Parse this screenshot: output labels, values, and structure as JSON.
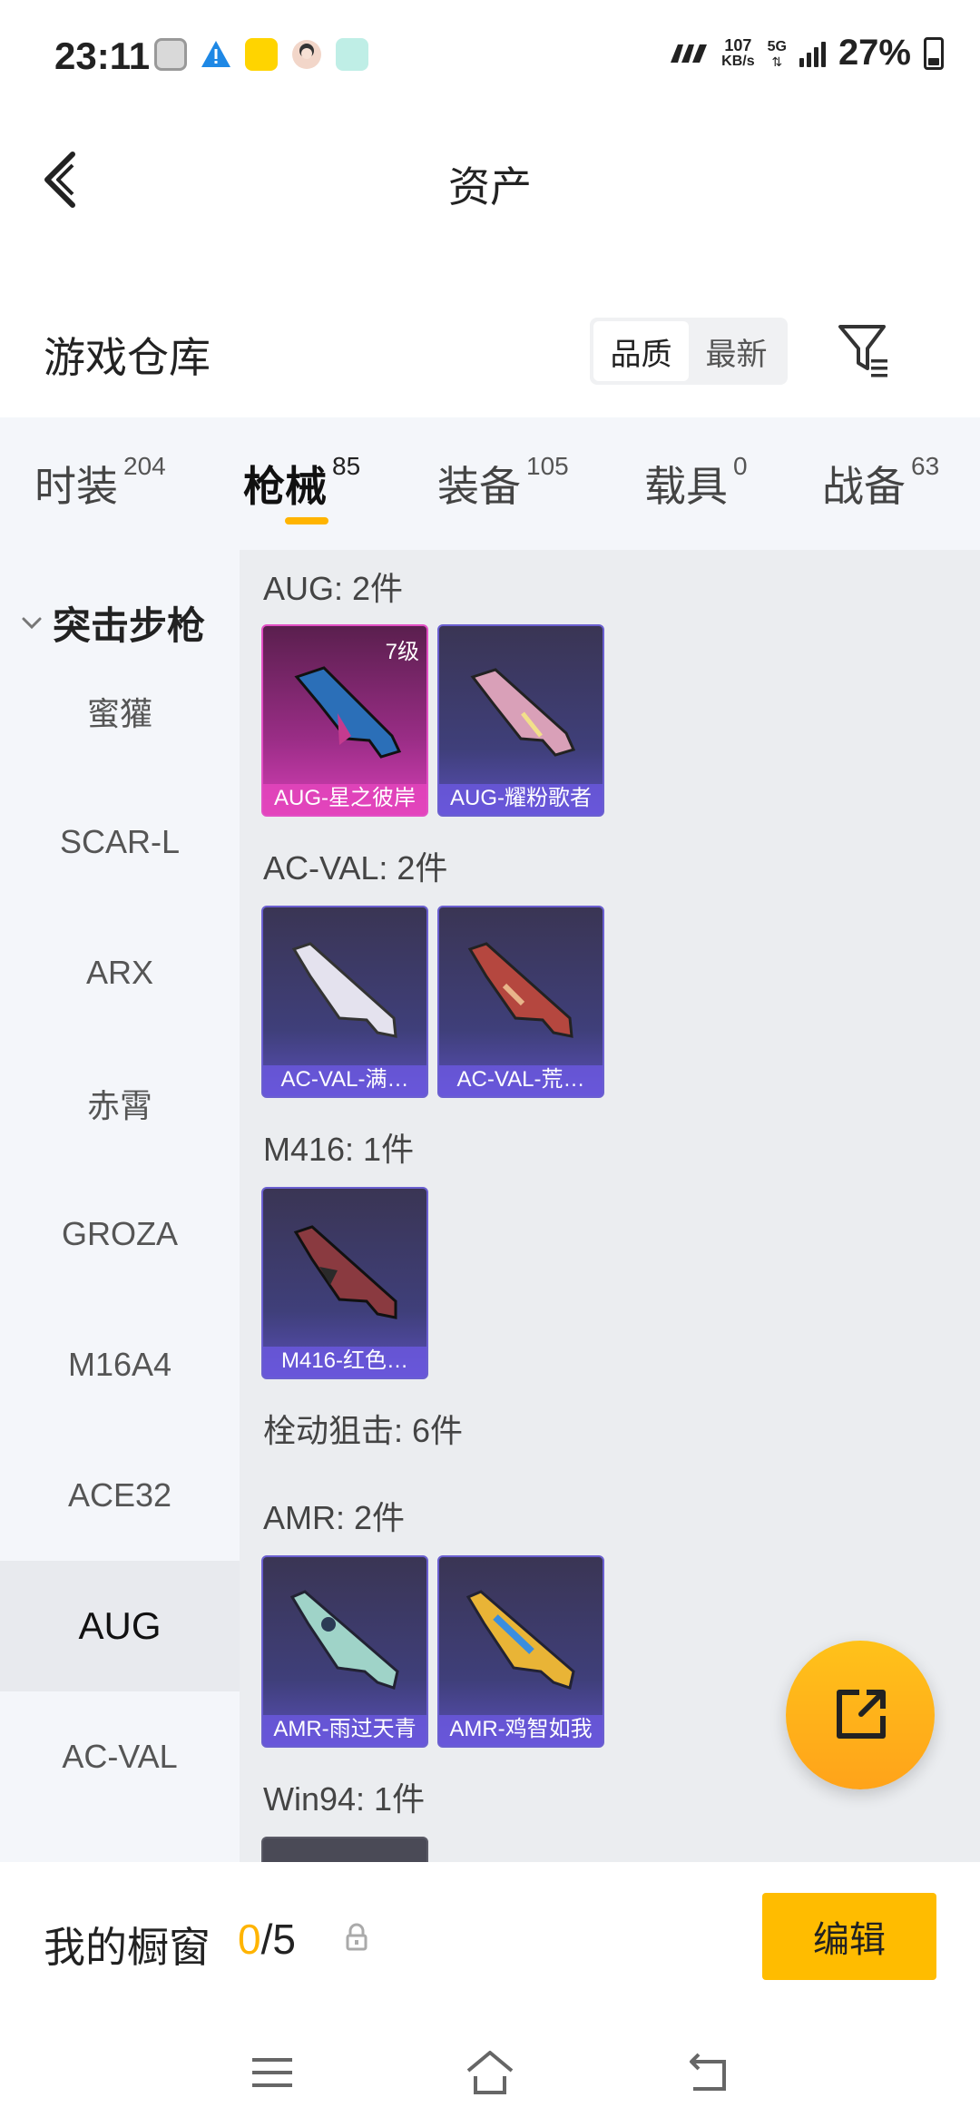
{
  "status_bar": {
    "time": "23:11",
    "net_speed_value": "107",
    "net_speed_unit": "KB/s",
    "network": "5G",
    "battery": "27%"
  },
  "header": {
    "title": "资产"
  },
  "warehouse": {
    "title": "游戏仓库",
    "sort_options": [
      "品质",
      "最新"
    ],
    "active_sort": "品质"
  },
  "tabs": [
    {
      "label": "时装",
      "count": "204"
    },
    {
      "label": "枪械",
      "count": "85"
    },
    {
      "label": "装备",
      "count": "105"
    },
    {
      "label": "载具",
      "count": "0"
    },
    {
      "label": "战备",
      "count": "63"
    }
  ],
  "active_tab": "枪械",
  "sidebar": {
    "category": "突击步枪",
    "items": [
      "蜜獾",
      "SCAR-L",
      "ARX",
      "赤霄",
      "GROZA",
      "M16A4",
      "ACE32",
      "AUG",
      "AC-VAL"
    ],
    "active_item": "AUG"
  },
  "groups": [
    {
      "title": "AUG: 2件",
      "items": [
        {
          "label": "AUG-星之彼岸",
          "level": "7级",
          "rarity": "pink"
        },
        {
          "label": "AUG-耀粉歌者",
          "rarity": "purple"
        }
      ]
    },
    {
      "title": "AC-VAL: 2件",
      "items": [
        {
          "label": "AC-VAL-满…",
          "rarity": "purple"
        },
        {
          "label": "AC-VAL-荒…",
          "rarity": "purple"
        }
      ]
    },
    {
      "title": "M416: 1件",
      "items": [
        {
          "label": "M416-红色…",
          "rarity": "purple"
        }
      ]
    },
    {
      "title": "栓动狙击: 6件",
      "items": []
    },
    {
      "title": "AMR: 2件",
      "items": [
        {
          "label": "AMR-雨过天青",
          "rarity": "purple"
        },
        {
          "label": "AMR-鸡智如我",
          "rarity": "purple"
        }
      ]
    },
    {
      "title": "Win94: 1件",
      "items": []
    }
  ],
  "showcase": {
    "title": "我的橱窗",
    "current": "0",
    "total": "/5",
    "edit_label": "编辑"
  },
  "colors": {
    "accent": "#ffb400",
    "pink_rarity": "#d63fb6",
    "purple_rarity": "#5a4fb8"
  }
}
